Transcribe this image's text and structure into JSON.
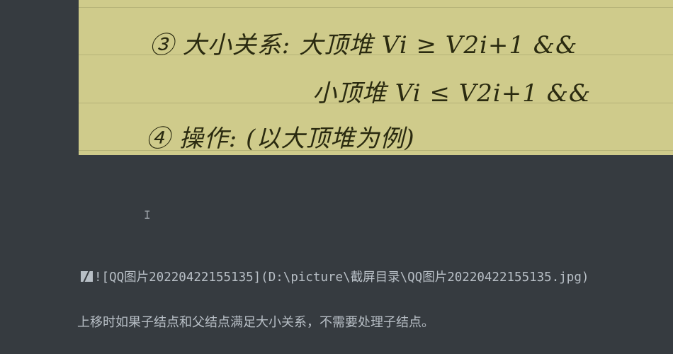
{
  "image": {
    "handwritten_lines": [
      "③ 大小关系:  大顶堆     Vi ≥ V2i+1   &&",
      "小顶堆     Vi ≤ V2i+1   &&",
      "④ 操作:  (以大顶堆为例)"
    ]
  },
  "editor": {
    "image_source": "![QQ图片20220422155135](D:\\picture\\截屏目录\\QQ图片20220422155135.jpg)",
    "paragraph": "上移时如果子结点和父结点满足大小关系，不需要处理子结点。",
    "cursor_glyph": "I"
  }
}
